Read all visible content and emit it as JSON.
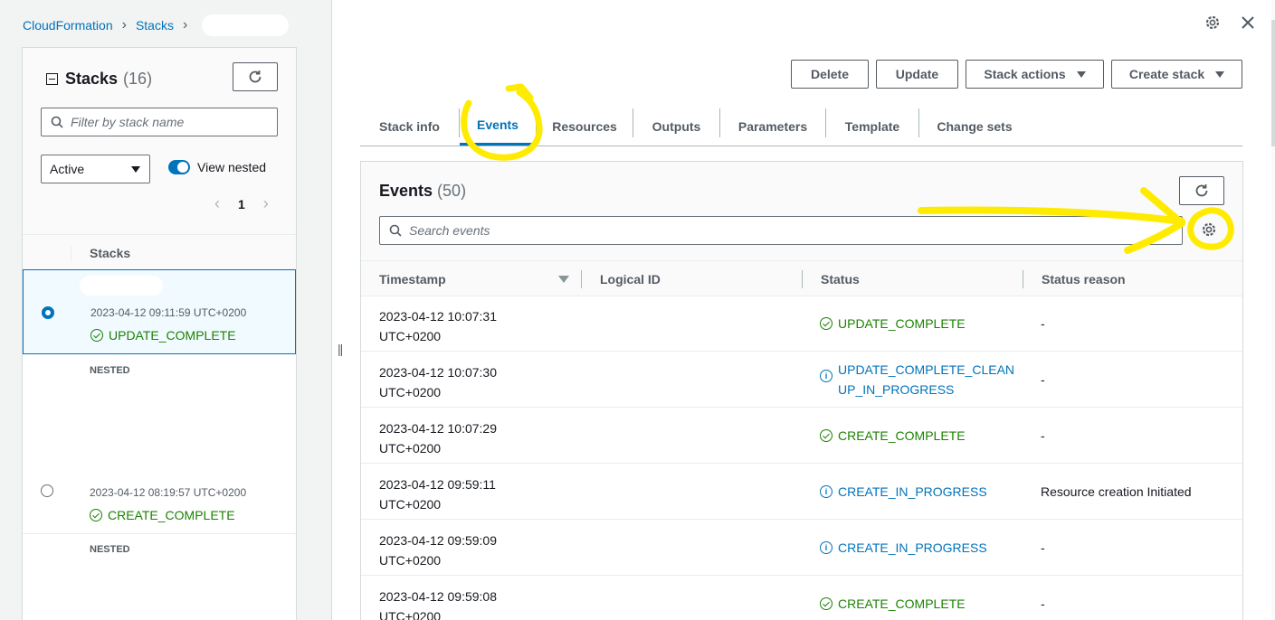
{
  "breadcrumb": {
    "root": "CloudFormation",
    "stacks": "Stacks"
  },
  "stacks_panel": {
    "title": "Stacks",
    "count": "(16)",
    "filter_placeholder": "Filter by stack name",
    "filter_select": "Active",
    "view_nested_label": "View nested",
    "page": "1",
    "column_header": "Stacks",
    "rows": [
      {
        "date": "2023-04-12 09:11:59 UTC+0200",
        "status": "UPDATE_COMPLETE",
        "nested": "NESTED"
      },
      {
        "date": "2023-04-12 08:19:57 UTC+0200",
        "status": "CREATE_COMPLETE",
        "nested": "NESTED"
      }
    ]
  },
  "actions": {
    "delete": "Delete",
    "update": "Update",
    "stack_actions": "Stack actions",
    "create_stack": "Create stack"
  },
  "tabs": [
    "Stack info",
    "Events",
    "Resources",
    "Outputs",
    "Parameters",
    "Template",
    "Change sets"
  ],
  "events": {
    "title": "Events",
    "count": "(50)",
    "search_placeholder": "Search events",
    "columns": [
      "Timestamp",
      "Logical ID",
      "Status",
      "Status reason"
    ],
    "rows": [
      {
        "ts1": "2023-04-12 10:07:31",
        "ts2": "UTC+0200",
        "status": "UPDATE_COMPLETE",
        "kind": "ok",
        "reason": "-"
      },
      {
        "ts1": "2023-04-12 10:07:30",
        "ts2": "UTC+0200",
        "status": "UPDATE_COMPLETE_CLEAN",
        "status2": "UP_IN_PROGRESS",
        "kind": "info",
        "reason": "-"
      },
      {
        "ts1": "2023-04-12 10:07:29",
        "ts2": "UTC+0200",
        "status": "CREATE_COMPLETE",
        "kind": "ok",
        "reason": "-"
      },
      {
        "ts1": "2023-04-12 09:59:11",
        "ts2": "UTC+0200",
        "status": "CREATE_IN_PROGRESS",
        "kind": "info",
        "reason": "Resource creation Initiated"
      },
      {
        "ts1": "2023-04-12 09:59:09",
        "ts2": "UTC+0200",
        "status": "CREATE_IN_PROGRESS",
        "kind": "info",
        "reason": "-"
      },
      {
        "ts1": "2023-04-12 09:59:08",
        "ts2": "UTC+0200",
        "status": "CREATE_COMPLETE",
        "kind": "ok",
        "reason": "-"
      }
    ]
  },
  "colors": {
    "link": "#0073bb",
    "success": "#1d8102",
    "highlight": "#ffeb00"
  }
}
